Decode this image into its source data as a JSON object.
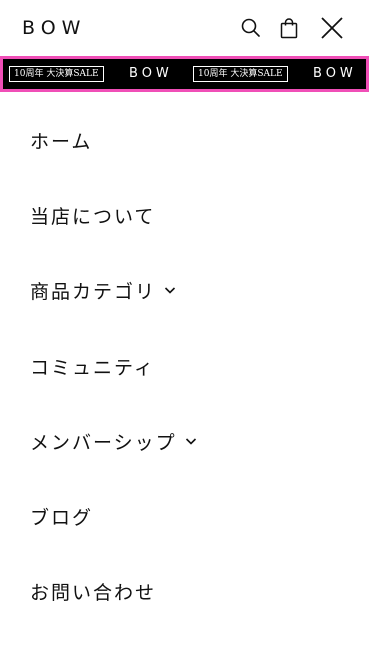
{
  "header": {
    "logo": "BOW",
    "icons": [
      "search-icon",
      "shopping-bag-icon",
      "close-icon"
    ]
  },
  "banner": {
    "badge_text": "10周年 大決算SALE",
    "logo_text": "BOW",
    "highlight_color": "#f04fb7",
    "background": "#000000"
  },
  "menu": {
    "items": [
      {
        "label": "ホーム",
        "has_submenu": false
      },
      {
        "label": "当店について",
        "has_submenu": false
      },
      {
        "label": "商品カテゴリ",
        "has_submenu": true
      },
      {
        "label": "コミュニティ",
        "has_submenu": false
      },
      {
        "label": "メンバーシップ",
        "has_submenu": true
      },
      {
        "label": "ブログ",
        "has_submenu": false
      },
      {
        "label": "お問い合わせ",
        "has_submenu": false
      }
    ]
  }
}
